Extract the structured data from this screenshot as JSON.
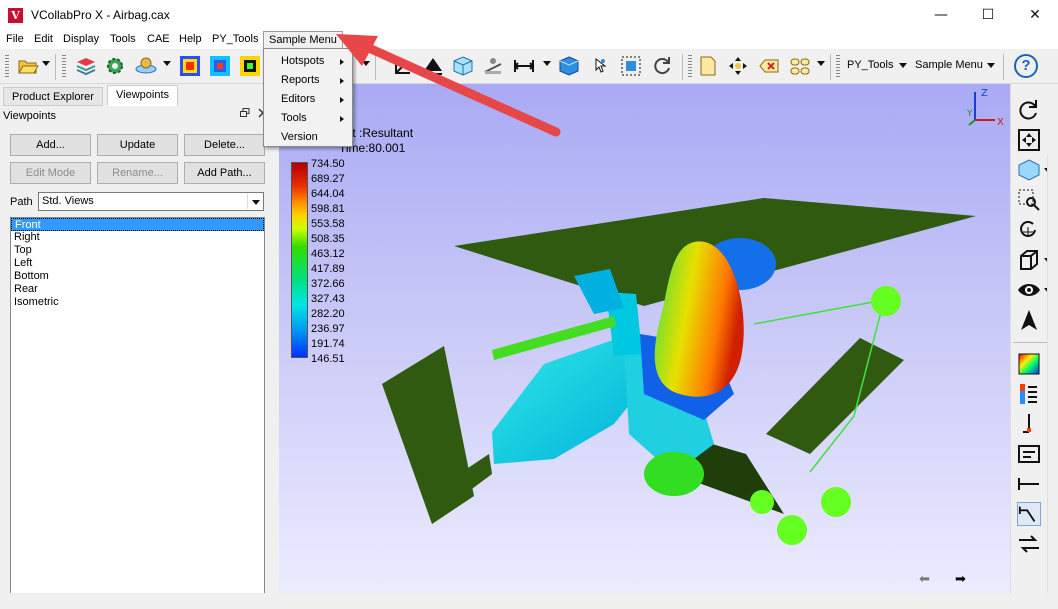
{
  "window": {
    "title": "VCollabPro X - Airbag.cax",
    "logo_letter": "V",
    "minimize_glyph": "—",
    "maximize_glyph": "☐",
    "close_glyph": "✕"
  },
  "menubar": {
    "items": [
      "File",
      "Edit",
      "Display",
      "Tools",
      "CAE",
      "Help",
      "PY_Tools",
      "Sample Menu"
    ]
  },
  "sample_menu": {
    "items": [
      {
        "label": "Hotspots",
        "has_submenu": true
      },
      {
        "label": "Reports",
        "has_submenu": true
      },
      {
        "label": "Editors",
        "has_submenu": true
      },
      {
        "label": "Tools",
        "has_submenu": true
      },
      {
        "label": "Version",
        "has_submenu": false
      }
    ]
  },
  "toolbar": {
    "py_tools_label": "PY_Tools",
    "sample_menu_label": "Sample Menu",
    "help_glyph": "?"
  },
  "left_panel": {
    "tabs": [
      "Product Explorer",
      "Viewpoints"
    ],
    "active_tab": "Viewpoints",
    "caption": "Viewpoints",
    "buttons": {
      "add": "Add...",
      "update": "Update",
      "delete": "Delete...",
      "edit_mode": "Edit Mode",
      "rename": "Rename...",
      "add_path": "Add Path..."
    },
    "path_label": "Path",
    "path_value": "Std. Views",
    "views": [
      "Front",
      "Right",
      "Top",
      "Left",
      "Bottom",
      "Rear",
      "Isometric"
    ],
    "selected_view": "Front"
  },
  "viewport": {
    "result_label": "ent :Resultant",
    "frame_label": "Time:80.001",
    "legend_values": [
      "734.50",
      "689.27",
      "644.04",
      "598.81",
      "553.58",
      "508.35",
      "463.12",
      "417.89",
      "372.66",
      "327.43",
      "282.20",
      "236.97",
      "191.74",
      "146.51"
    ],
    "triad": {
      "x": "X",
      "y": "Y",
      "z": "Z"
    },
    "prev_glyph": "⬅",
    "next_glyph": "➡"
  },
  "colors": {
    "accent": "#3399ff",
    "annotation_arrow": "#e8474a",
    "viewport_top": "#a9aaf4",
    "plate_green": "#2f5a10"
  }
}
